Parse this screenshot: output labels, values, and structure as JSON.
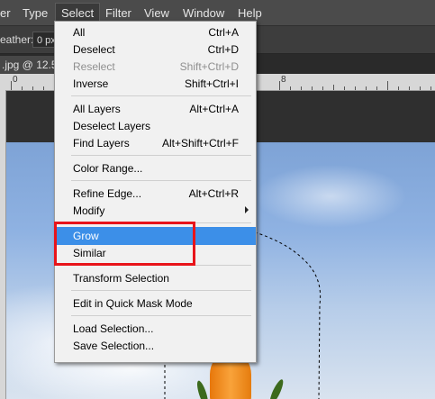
{
  "menubar": {
    "items": [
      {
        "label": "er"
      },
      {
        "label": "Type"
      },
      {
        "label": "Select"
      },
      {
        "label": "Filter"
      },
      {
        "label": "View"
      },
      {
        "label": "Window"
      },
      {
        "label": "Help"
      }
    ]
  },
  "options": {
    "feather_label": "eather:",
    "feather_value": "0 px"
  },
  "document": {
    "tab_label": ".jpg @ 12.5"
  },
  "ruler": {
    "labels": [
      "0",
      "8"
    ]
  },
  "select_menu": {
    "items": [
      {
        "label": "All",
        "shortcut": "Ctrl+A"
      },
      {
        "label": "Deselect",
        "shortcut": "Ctrl+D"
      },
      {
        "label": "Reselect",
        "shortcut": "Shift+Ctrl+D"
      },
      {
        "label": "Inverse",
        "shortcut": "Shift+Ctrl+I"
      },
      {
        "label": "All Layers",
        "shortcut": "Alt+Ctrl+A"
      },
      {
        "label": "Deselect Layers",
        "shortcut": ""
      },
      {
        "label": "Find Layers",
        "shortcut": "Alt+Shift+Ctrl+F"
      },
      {
        "label": "Color Range...",
        "shortcut": ""
      },
      {
        "label": "Refine Edge...",
        "shortcut": "Alt+Ctrl+R"
      },
      {
        "label": "Modify",
        "shortcut": ""
      },
      {
        "label": "Grow",
        "shortcut": ""
      },
      {
        "label": "Similar",
        "shortcut": ""
      },
      {
        "label": "Transform Selection",
        "shortcut": ""
      },
      {
        "label": "Edit in Quick Mask Mode",
        "shortcut": ""
      },
      {
        "label": "Load Selection...",
        "shortcut": ""
      },
      {
        "label": "Save Selection...",
        "shortcut": ""
      }
    ],
    "highlighted": "Grow",
    "disabled": "Reselect",
    "highlight_color": "#3c8fe8",
    "annotation_color": "#e8141a"
  }
}
